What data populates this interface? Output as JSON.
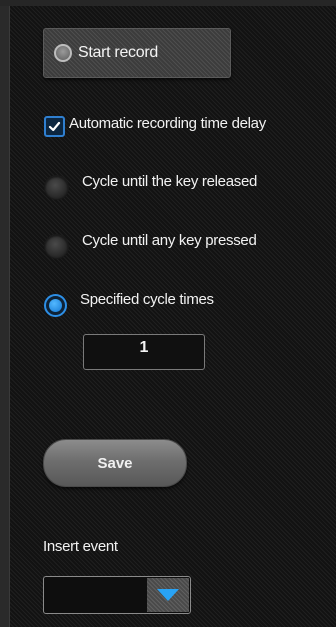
{
  "record": {
    "start_label": "Start record"
  },
  "options": {
    "auto_delay_label": "Automatic recording time delay",
    "auto_delay_checked": true,
    "cycle_release_label": "Cycle until the key released",
    "cycle_any_key_label": "Cycle until any key pressed",
    "specified_cycles_label": "Specified cycle times",
    "selected_mode": "specified_cycles"
  },
  "cycle_times": {
    "value": "1"
  },
  "actions": {
    "save_label": "Save"
  },
  "insert_event": {
    "label": "Insert event",
    "selected_value": ""
  },
  "colors": {
    "accent": "#2d8fe6",
    "background": "#121212"
  },
  "icons": {
    "checkbox": "checkmark-icon",
    "dropdown": "triangle-down-icon"
  }
}
